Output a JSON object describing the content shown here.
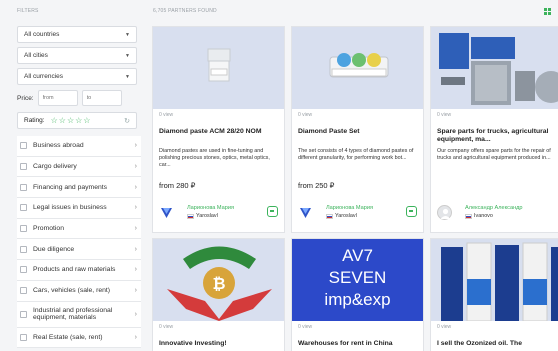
{
  "filters": {
    "label": "FILTERS",
    "country": "All countries",
    "city": "All cities",
    "currency": "All currencies",
    "price_label": "Price:",
    "price_from": "from",
    "price_to": "to",
    "rating_label": "Rating:",
    "rating_stars": "☆☆☆☆☆"
  },
  "categories": [
    "Business abroad",
    "Cargo delivery",
    "Financing and payments",
    "Legal issues in business",
    "Promotion",
    "Due diligence",
    "Products and raw materials",
    "Cars, vehicles (sale, rent)",
    "Industrial and professional equipment,  materials",
    "Real Estate (sale, rent)"
  ],
  "results": {
    "found_label": "6,705 PARTNERS FOUND"
  },
  "cards": [
    {
      "views": "0 view",
      "title": "Diamond paste ACM 28/20 NOM",
      "desc": "Diamond pastes are used in fine-tuning and polishing precious stones, optics, metal optics, car...",
      "price": "from 280 ₽",
      "seller": "Ларионова Мария",
      "city": "Yaroslavl"
    },
    {
      "views": "0 view",
      "title": "Diamond Paste Set",
      "desc": "The set consists of 4 types of diamond pastes of different granularity, for performing work bot...",
      "price": "from 250 ₽",
      "seller": "Ларионова Мария",
      "city": "Yaroslavl"
    },
    {
      "views": "0 view",
      "title": "Spare parts for trucks, agricultural equipment, ma...",
      "desc": "Our company offers spare parts for the repair of trucks and agricultural equipment produced in...",
      "price": "",
      "seller": "Александр Александр",
      "city": "Ivanovo"
    }
  ],
  "cards_row2": [
    {
      "views": "0 view",
      "title": "Innovative Investing!",
      "banner": ""
    },
    {
      "views": "0 view",
      "title": "Warehouses for rent in China",
      "banner": "AV7\nSEVEN\nimp&exp"
    },
    {
      "views": "0 view",
      "title": "I sell the Ozonized oil. The",
      "banner": ""
    }
  ],
  "colors": {
    "accent": "#3cb35c",
    "image_tint": "#d8dfef",
    "av7_blue": "#2c49c9"
  }
}
